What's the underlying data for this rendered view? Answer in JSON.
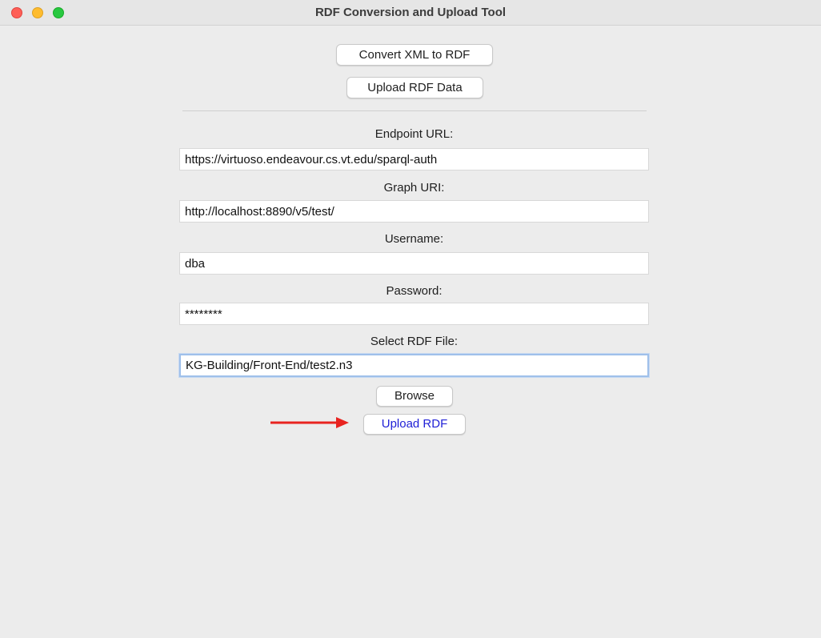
{
  "window": {
    "title": "RDF Conversion and Upload Tool"
  },
  "toolbar": {
    "convert_label": "Convert XML to RDF",
    "upload_data_label": "Upload RDF Data"
  },
  "form": {
    "endpoint": {
      "label": "Endpoint URL:",
      "value": "https://virtuoso.endeavour.cs.vt.edu/sparql-auth"
    },
    "graph": {
      "label": "Graph URI:",
      "value": "http://localhost:8890/v5/test/"
    },
    "username": {
      "label": "Username:",
      "value": "dba"
    },
    "password": {
      "label": "Password:",
      "value": "********"
    },
    "file": {
      "label": "Select RDF File:",
      "value": "KG-Building/Front-End/test2.n3"
    }
  },
  "actions": {
    "browse_label": "Browse",
    "upload_rdf_label": "Upload RDF"
  },
  "colors": {
    "annotation_arrow": "#e8231f",
    "upload_rdf_text": "#1f1fd6",
    "focus_ring": "#9fc0ea"
  },
  "icons": {
    "annotation": "right-arrow-icon"
  }
}
